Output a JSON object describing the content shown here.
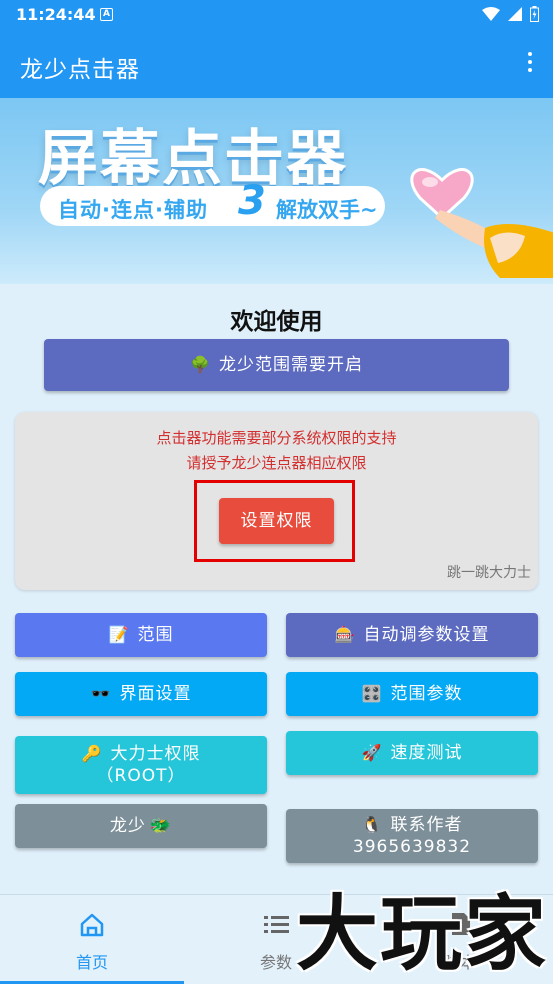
{
  "status": {
    "time": "11:24:44",
    "notif_glyph": "A"
  },
  "appbar": {
    "title": "龙少点击器",
    "menu_icon": "more-vert-icon"
  },
  "banner": {
    "headline": "屏幕点击器",
    "tagline_left": "自动·连点·辅助",
    "tagline_num": "3",
    "tagline_right": "解放双手~"
  },
  "welcome": "欢迎使用",
  "range_button": {
    "emoji": "🌳",
    "label": "龙少范围需要开启"
  },
  "perm_card": {
    "line1": "点击器功能需要部分系统权限的支持",
    "line2": "请授予龙少连点器相应权限",
    "button": "设置权限",
    "watermark": "跳一跳大力士"
  },
  "grid": {
    "range": {
      "emoji": "📝",
      "label": "范围"
    },
    "auto_tune": {
      "emoji": "🎰",
      "label": "自动调参数设置"
    },
    "ui_settings": {
      "emoji": "🕶️",
      "label": "界面设置"
    },
    "range_params": {
      "emoji": "🎛️",
      "label": "范围参数"
    },
    "root": {
      "emoji": "🔑",
      "label": "大力士权限",
      "sub": "（ROOT）"
    },
    "speed_test": {
      "emoji": "🚀",
      "label": "速度测试"
    },
    "longshao": {
      "label": "龙少",
      "emoji": "🐲"
    },
    "contact": {
      "emoji": "🐧",
      "label": "联系作者",
      "number": "3965639832"
    }
  },
  "nav": {
    "home": "首页",
    "params": "参数",
    "script": "脚本"
  },
  "overlay_watermark": "大玩家",
  "colors": {
    "primary": "#2196f3",
    "danger": "#e74c3c",
    "indigo": "#5c6bc0"
  }
}
